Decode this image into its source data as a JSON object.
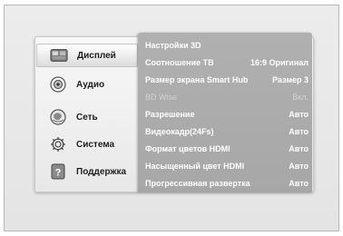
{
  "sidebar": {
    "items": [
      {
        "label": "Дисплей",
        "icon": "display-icon",
        "active": true
      },
      {
        "label": "Аудио",
        "icon": "audio-icon",
        "active": false
      },
      {
        "label": "Сеть",
        "icon": "network-icon",
        "active": false
      },
      {
        "label": "Система",
        "icon": "system-gear-icon",
        "active": false
      },
      {
        "label": "Поддержка",
        "icon": "support-icon",
        "active": false
      }
    ]
  },
  "panel": {
    "rows": [
      {
        "label": "Настройки 3D",
        "value": ""
      },
      {
        "label": "Соотношение ТВ",
        "value": "16:9 Оригинал"
      },
      {
        "label": "Размер экрана Smart Hub",
        "value": "Размер 3"
      },
      {
        "label": "BD Wise",
        "value": "Вкл.",
        "disabled": true
      },
      {
        "label": "Разрешение",
        "value": "Авто"
      },
      {
        "label": "Видеокадр(24Fs)",
        "value": "Авто"
      },
      {
        "label": "Формат цветов HDMI",
        "value": "Авто"
      },
      {
        "label": "Насыщенный цвет HDMI",
        "value": "Авто"
      },
      {
        "label": "Прогрессивная развертка",
        "value": "Авто"
      }
    ]
  },
  "colors": {
    "panel_bg": "#ababab",
    "menu_bg": "#f0f0f0",
    "text_active": "#ffffff",
    "text_disabled": "#d2d2d2"
  }
}
